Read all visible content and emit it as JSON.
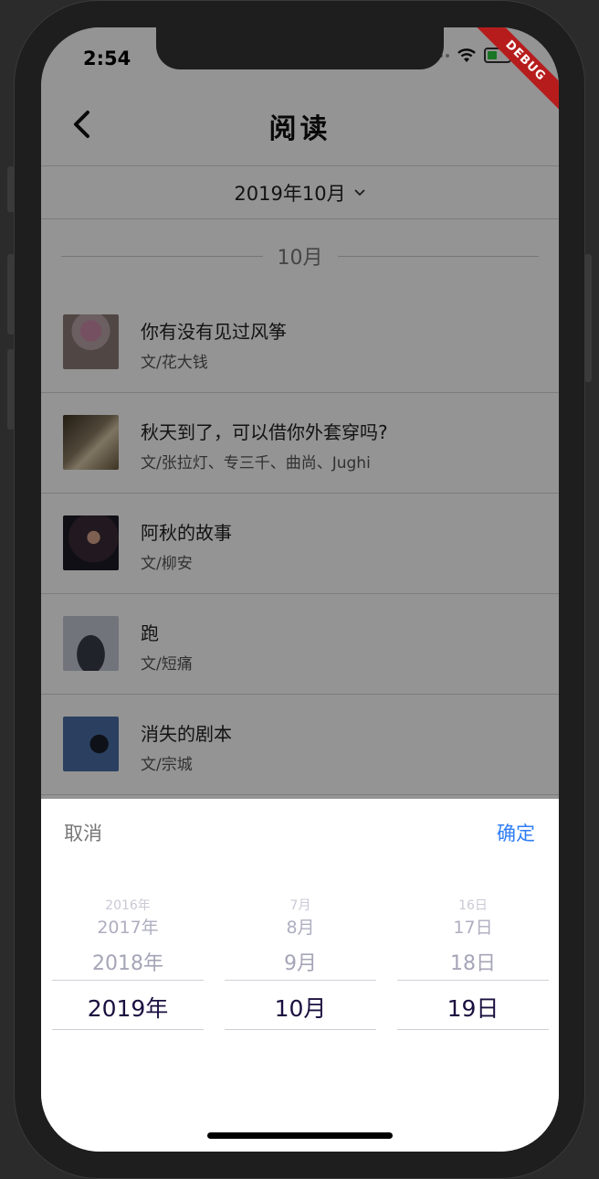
{
  "status_bar": {
    "time": "2:54",
    "debug_label": "DEBUG"
  },
  "header": {
    "title": "阅读"
  },
  "month_selector": {
    "label": "2019年10月"
  },
  "section": {
    "label": "10月"
  },
  "articles": [
    {
      "title": "你有没有见过风筝",
      "author": "文/花大钱"
    },
    {
      "title": "秋天到了，可以借你外套穿吗?",
      "author": "文/张拉灯、专三千、曲尚、Jughi"
    },
    {
      "title": "阿秋的故事",
      "author": "文/柳安"
    },
    {
      "title": "跑",
      "author": "文/短痛"
    },
    {
      "title": "消失的剧本",
      "author": "文/宗城"
    }
  ],
  "picker": {
    "cancel_label": "取消",
    "confirm_label": "确定",
    "year": {
      "items": [
        "2016年",
        "2017年",
        "2018年",
        "2019年"
      ]
    },
    "month": {
      "items": [
        "7月",
        "8月",
        "9月",
        "10月"
      ]
    },
    "day": {
      "items": [
        "16日",
        "17日",
        "18日",
        "19日"
      ]
    }
  },
  "colors": {
    "accent": "#2f7ef5",
    "selected_text": "#1b1040",
    "debug_ribbon": "#b71c1c"
  }
}
